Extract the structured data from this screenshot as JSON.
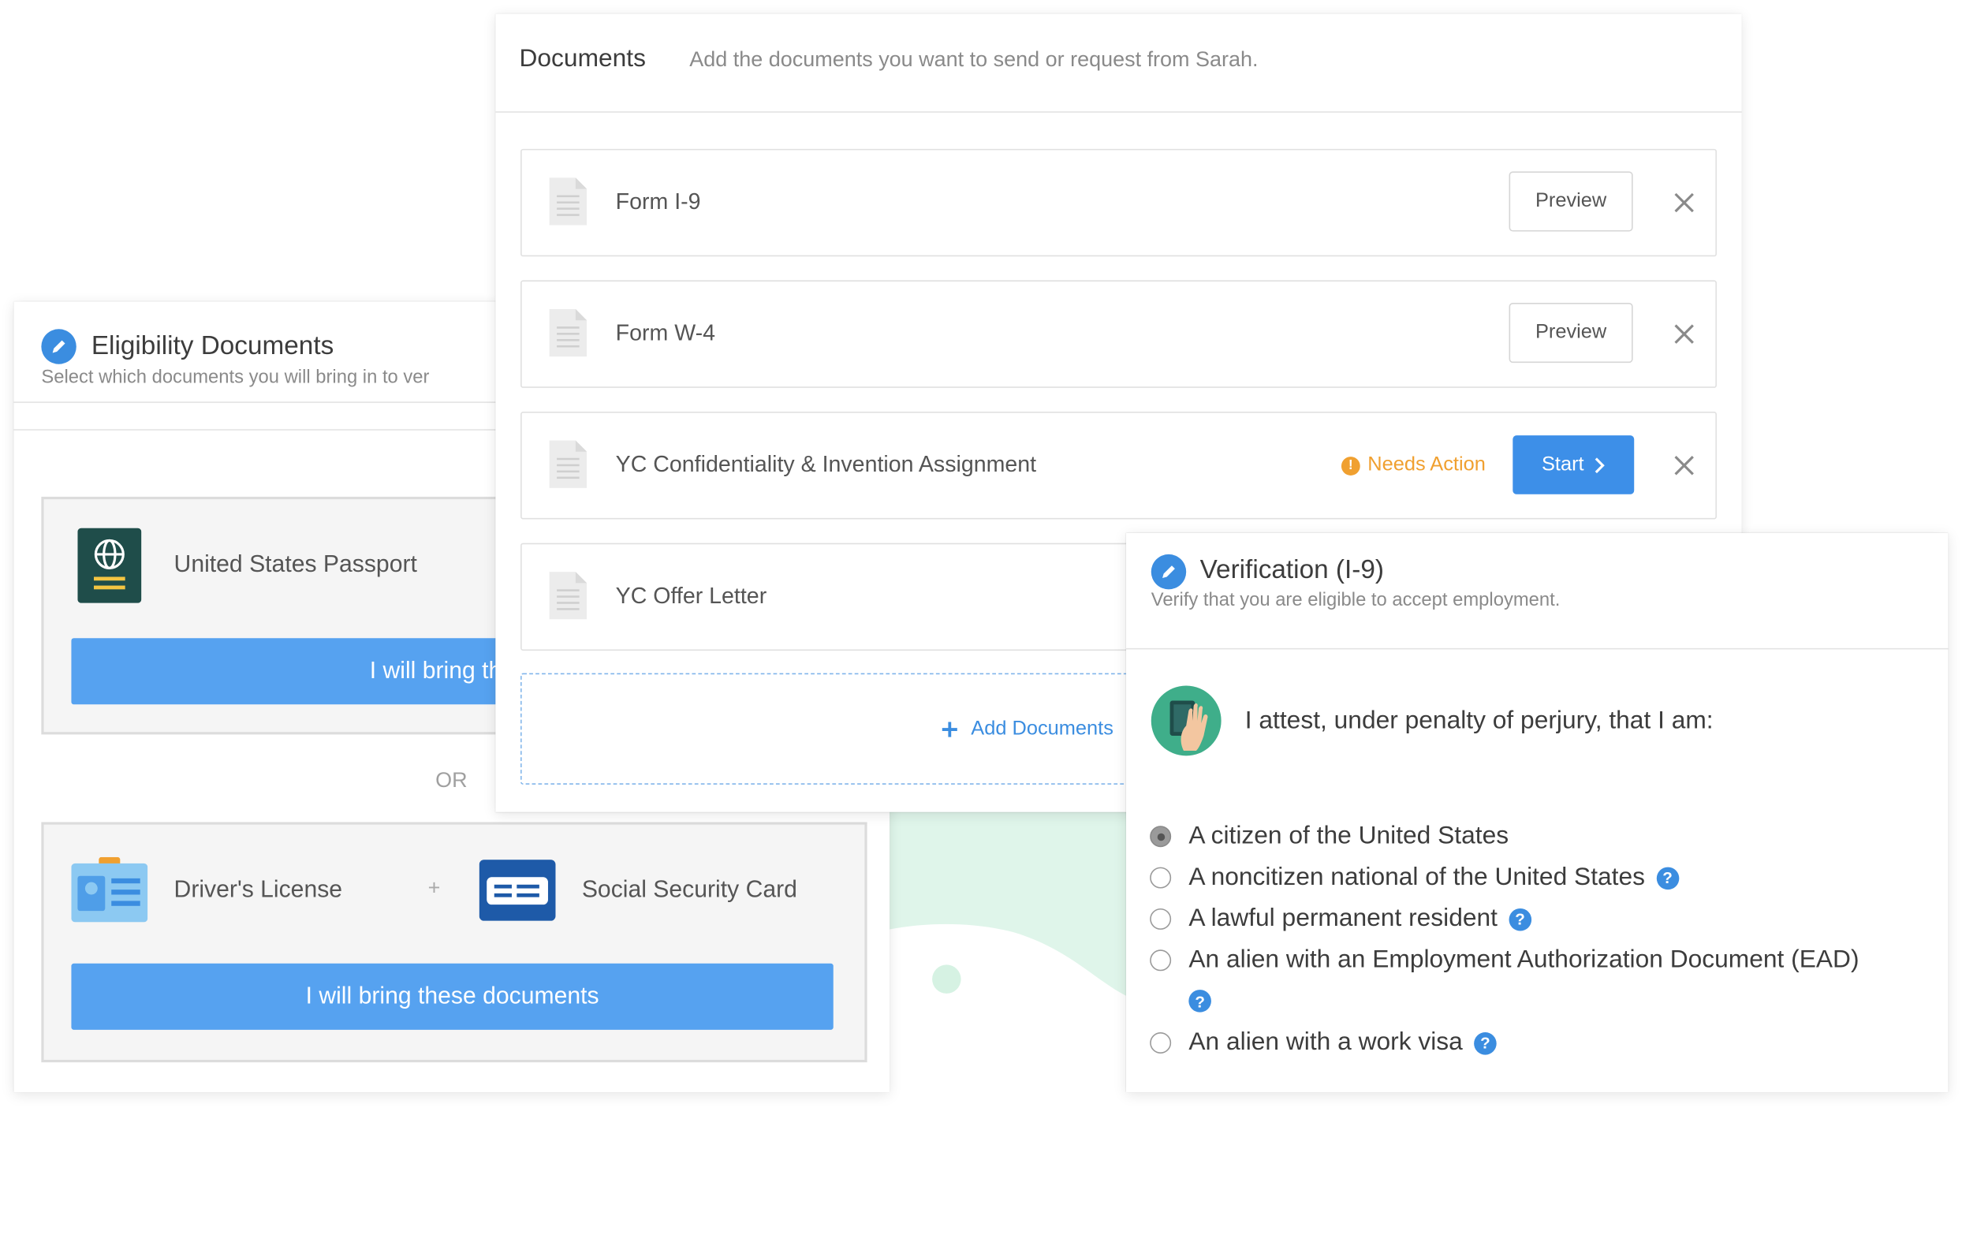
{
  "colors": {
    "primary_blue": "#56a2f0",
    "accent_blue": "#3b8de0",
    "warning_orange": "#f0a030",
    "mint": "#dff5ea"
  },
  "eligibility": {
    "title": "Eligibility Documents",
    "subtitle": "Select which documents you will bring in to ver",
    "option_one": {
      "doc_label": "United States Passport",
      "icon": "passport-icon",
      "button_label": "I will bring this d"
    },
    "or_label": "OR",
    "option_two": {
      "doc_one_label": "Driver's License",
      "doc_one_icon": "drivers-license-icon",
      "plus": "+",
      "doc_two_label": "Social Security Card",
      "doc_two_icon": "social-security-card-icon",
      "button_label": "I will bring these documents"
    }
  },
  "documents": {
    "title": "Documents",
    "subtitle": "Add the documents you want to send or request from Sarah.",
    "rows": [
      {
        "name": "Form I-9",
        "action": "Preview"
      },
      {
        "name": "Form W-4",
        "action": "Preview"
      },
      {
        "name": "YC Confidentiality & Invention Assignment",
        "status": "Needs Action",
        "action": "Start"
      },
      {
        "name": "YC Offer Letter"
      }
    ],
    "add_label": "Add Documents"
  },
  "verification": {
    "title": "Verification (I-9)",
    "subtitle": "Verify that you are eligible to accept employment.",
    "attest": "I attest, under penalty of perjury, that I am:",
    "options": [
      {
        "label": "A citizen of the United States",
        "checked": true,
        "help": false
      },
      {
        "label": "A noncitizen national of the United States",
        "checked": false,
        "help": true
      },
      {
        "label": "A lawful permanent resident",
        "checked": false,
        "help": true
      },
      {
        "label": "An alien with an Employment Authorization Document (EAD)",
        "checked": false,
        "help": true
      },
      {
        "label": "An alien with a work visa",
        "checked": false,
        "help": true
      }
    ]
  }
}
